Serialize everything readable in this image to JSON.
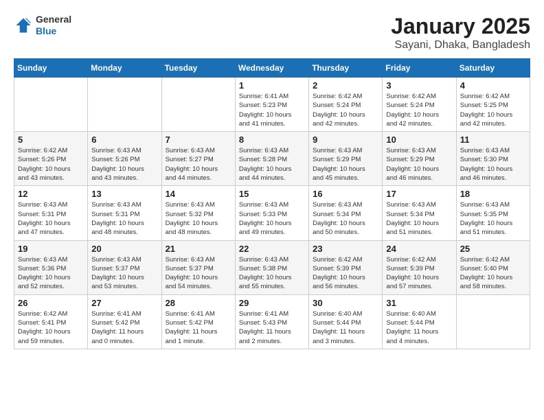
{
  "header": {
    "logo_general": "General",
    "logo_blue": "Blue",
    "title": "January 2025",
    "location": "Sayani, Dhaka, Bangladesh"
  },
  "weekdays": [
    "Sunday",
    "Monday",
    "Tuesday",
    "Wednesday",
    "Thursday",
    "Friday",
    "Saturday"
  ],
  "weeks": [
    [
      {
        "day": "",
        "info": ""
      },
      {
        "day": "",
        "info": ""
      },
      {
        "day": "",
        "info": ""
      },
      {
        "day": "1",
        "info": "Sunrise: 6:41 AM\nSunset: 5:23 PM\nDaylight: 10 hours\nand 41 minutes."
      },
      {
        "day": "2",
        "info": "Sunrise: 6:42 AM\nSunset: 5:24 PM\nDaylight: 10 hours\nand 42 minutes."
      },
      {
        "day": "3",
        "info": "Sunrise: 6:42 AM\nSunset: 5:24 PM\nDaylight: 10 hours\nand 42 minutes."
      },
      {
        "day": "4",
        "info": "Sunrise: 6:42 AM\nSunset: 5:25 PM\nDaylight: 10 hours\nand 42 minutes."
      }
    ],
    [
      {
        "day": "5",
        "info": "Sunrise: 6:42 AM\nSunset: 5:26 PM\nDaylight: 10 hours\nand 43 minutes."
      },
      {
        "day": "6",
        "info": "Sunrise: 6:43 AM\nSunset: 5:26 PM\nDaylight: 10 hours\nand 43 minutes."
      },
      {
        "day": "7",
        "info": "Sunrise: 6:43 AM\nSunset: 5:27 PM\nDaylight: 10 hours\nand 44 minutes."
      },
      {
        "day": "8",
        "info": "Sunrise: 6:43 AM\nSunset: 5:28 PM\nDaylight: 10 hours\nand 44 minutes."
      },
      {
        "day": "9",
        "info": "Sunrise: 6:43 AM\nSunset: 5:29 PM\nDaylight: 10 hours\nand 45 minutes."
      },
      {
        "day": "10",
        "info": "Sunrise: 6:43 AM\nSunset: 5:29 PM\nDaylight: 10 hours\nand 46 minutes."
      },
      {
        "day": "11",
        "info": "Sunrise: 6:43 AM\nSunset: 5:30 PM\nDaylight: 10 hours\nand 46 minutes."
      }
    ],
    [
      {
        "day": "12",
        "info": "Sunrise: 6:43 AM\nSunset: 5:31 PM\nDaylight: 10 hours\nand 47 minutes."
      },
      {
        "day": "13",
        "info": "Sunrise: 6:43 AM\nSunset: 5:31 PM\nDaylight: 10 hours\nand 48 minutes."
      },
      {
        "day": "14",
        "info": "Sunrise: 6:43 AM\nSunset: 5:32 PM\nDaylight: 10 hours\nand 48 minutes."
      },
      {
        "day": "15",
        "info": "Sunrise: 6:43 AM\nSunset: 5:33 PM\nDaylight: 10 hours\nand 49 minutes."
      },
      {
        "day": "16",
        "info": "Sunrise: 6:43 AM\nSunset: 5:34 PM\nDaylight: 10 hours\nand 50 minutes."
      },
      {
        "day": "17",
        "info": "Sunrise: 6:43 AM\nSunset: 5:34 PM\nDaylight: 10 hours\nand 51 minutes."
      },
      {
        "day": "18",
        "info": "Sunrise: 6:43 AM\nSunset: 5:35 PM\nDaylight: 10 hours\nand 51 minutes."
      }
    ],
    [
      {
        "day": "19",
        "info": "Sunrise: 6:43 AM\nSunset: 5:36 PM\nDaylight: 10 hours\nand 52 minutes."
      },
      {
        "day": "20",
        "info": "Sunrise: 6:43 AM\nSunset: 5:37 PM\nDaylight: 10 hours\nand 53 minutes."
      },
      {
        "day": "21",
        "info": "Sunrise: 6:43 AM\nSunset: 5:37 PM\nDaylight: 10 hours\nand 54 minutes."
      },
      {
        "day": "22",
        "info": "Sunrise: 6:43 AM\nSunset: 5:38 PM\nDaylight: 10 hours\nand 55 minutes."
      },
      {
        "day": "23",
        "info": "Sunrise: 6:42 AM\nSunset: 5:39 PM\nDaylight: 10 hours\nand 56 minutes."
      },
      {
        "day": "24",
        "info": "Sunrise: 6:42 AM\nSunset: 5:39 PM\nDaylight: 10 hours\nand 57 minutes."
      },
      {
        "day": "25",
        "info": "Sunrise: 6:42 AM\nSunset: 5:40 PM\nDaylight: 10 hours\nand 58 minutes."
      }
    ],
    [
      {
        "day": "26",
        "info": "Sunrise: 6:42 AM\nSunset: 5:41 PM\nDaylight: 10 hours\nand 59 minutes."
      },
      {
        "day": "27",
        "info": "Sunrise: 6:41 AM\nSunset: 5:42 PM\nDaylight: 11 hours\nand 0 minutes."
      },
      {
        "day": "28",
        "info": "Sunrise: 6:41 AM\nSunset: 5:42 PM\nDaylight: 11 hours\nand 1 minute."
      },
      {
        "day": "29",
        "info": "Sunrise: 6:41 AM\nSunset: 5:43 PM\nDaylight: 11 hours\nand 2 minutes."
      },
      {
        "day": "30",
        "info": "Sunrise: 6:40 AM\nSunset: 5:44 PM\nDaylight: 11 hours\nand 3 minutes."
      },
      {
        "day": "31",
        "info": "Sunrise: 6:40 AM\nSunset: 5:44 PM\nDaylight: 11 hours\nand 4 minutes."
      },
      {
        "day": "",
        "info": ""
      }
    ]
  ]
}
